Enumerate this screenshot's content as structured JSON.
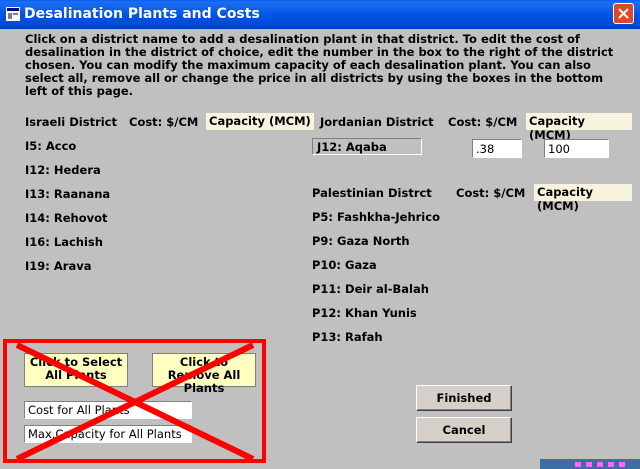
{
  "window": {
    "title": "Desalination Plants and Costs",
    "close_label": "×"
  },
  "intro_text": "Click on a district name to add a desalination plant in that district. To edit the cost of desalination in the district of choice, edit the number in the box to the right of the district chosen.  You can modify the maximum capacity of each desalination plant. You can also select all, remove all or change the price in all districts by using the boxes in the bottom left of this page.",
  "israeli": {
    "header": "Israeli District",
    "cost_header": "Cost: $/CM",
    "capacity_header": "Capacity (MCM)",
    "districts": [
      "I5: Acco",
      "I12: Hedera",
      "I13: Raanana",
      "I14: Rehovot",
      "I16: Lachish",
      "I19: Arava"
    ]
  },
  "jordanian": {
    "header": "Jordanian District",
    "cost_header": "Cost: $/CM",
    "capacity_header": "Capacity (MCM)",
    "selected_district": "J12: Aqaba",
    "cost_value": ".38",
    "capacity_value": "100"
  },
  "palestinian": {
    "header": "Palestinian Distrct",
    "cost_header": "Cost: $/CM",
    "capacity_header": "Capacity (MCM)",
    "districts": [
      "P5: Fashkha-Jehrico",
      "P9: Gaza North",
      "P10: Gaza",
      "P11: Deir al-Balah",
      "P12: Khan Yunis",
      "P13: Rafah"
    ]
  },
  "bulk": {
    "select_all": "Click to Select All Plants",
    "remove_all": "Click to Remove All Plants",
    "cost_all": "Cost for All Plants",
    "capacity_all": "Max.Capacity for All Plants"
  },
  "buttons": {
    "finished": "Finished",
    "cancel": "Cancel"
  },
  "colors": {
    "titlebar": "#0055e5",
    "client_bg": "#c0c0c0",
    "header_box": "#f7f3dc",
    "bulk_button": "#ffffc0",
    "red_cross": "#ff0000"
  }
}
